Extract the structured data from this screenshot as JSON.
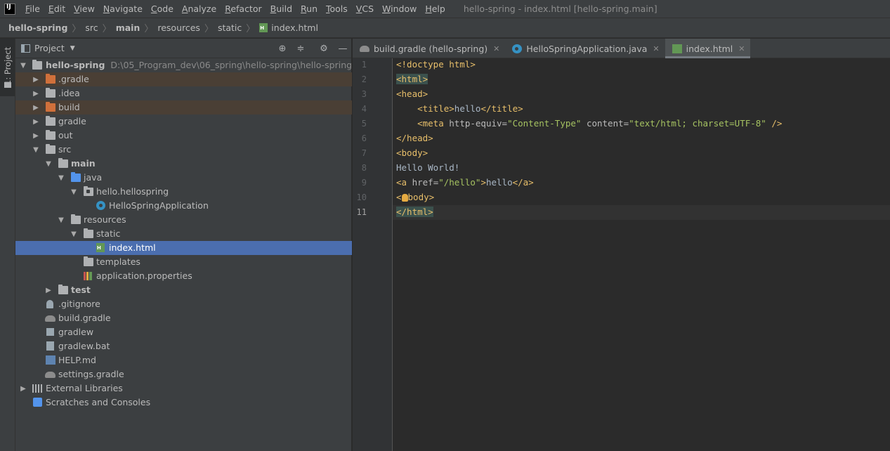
{
  "app": {
    "logo": "IJ",
    "window_title": "hello-spring - index.html [hello-spring.main]"
  },
  "menu": [
    "File",
    "Edit",
    "View",
    "Navigate",
    "Code",
    "Analyze",
    "Refactor",
    "Build",
    "Run",
    "Tools",
    "VCS",
    "Window",
    "Help"
  ],
  "breadcrumb": [
    "hello-spring",
    "src",
    "main",
    "resources",
    "static",
    "index.html"
  ],
  "left_stripe": {
    "label": "1: Project"
  },
  "project_panel": {
    "title": "Project"
  },
  "tree": [
    {
      "label": "hello-spring",
      "hint": "D:\\05_Program_dev\\06_spring\\hello-spring\\hello-spring",
      "icon": "module-folder-icon"
    },
    {
      "label": ".gradle",
      "icon": "folder-icon"
    },
    {
      "label": ".idea",
      "icon": "folder-icon"
    },
    {
      "label": "build",
      "icon": "folder-icon"
    },
    {
      "label": "gradle",
      "icon": "folder-icon"
    },
    {
      "label": "out",
      "icon": "folder-icon"
    },
    {
      "label": "src",
      "icon": "folder-icon"
    },
    {
      "label": "main",
      "icon": "folder-icon"
    },
    {
      "label": "java",
      "icon": "source-folder-icon"
    },
    {
      "label": "hello.hellospring",
      "icon": "package-icon"
    },
    {
      "label": "HelloSpringApplication",
      "icon": "spring-class-icon"
    },
    {
      "label": "resources",
      "icon": "resources-folder-icon"
    },
    {
      "label": "static",
      "icon": "folder-icon"
    },
    {
      "label": "index.html",
      "icon": "html-file-icon"
    },
    {
      "label": "templates",
      "icon": "folder-icon"
    },
    {
      "label": "application.properties",
      "icon": "properties-file-icon"
    },
    {
      "label": "test",
      "icon": "folder-icon"
    },
    {
      "label": ".gitignore",
      "icon": "gitignore-file-icon"
    },
    {
      "label": "build.gradle",
      "icon": "gradle-file-icon"
    },
    {
      "label": "gradlew",
      "icon": "shell-script-icon"
    },
    {
      "label": "gradlew.bat",
      "icon": "text-file-icon"
    },
    {
      "label": "HELP.md",
      "icon": "markdown-file-icon"
    },
    {
      "label": "settings.gradle",
      "icon": "gradle-file-icon"
    },
    {
      "label": "External Libraries",
      "icon": "libraries-icon"
    },
    {
      "label": "Scratches and Consoles",
      "icon": "scratches-icon"
    }
  ],
  "editor_tabs": [
    {
      "label": "build.gradle (hello-spring)",
      "icon": "gradle-file-icon"
    },
    {
      "label": "HelloSpringApplication.java",
      "icon": "spring-class-icon"
    },
    {
      "label": "index.html",
      "icon": "html-file-icon",
      "active": true
    }
  ],
  "line_numbers": [
    "1",
    "2",
    "3",
    "4",
    "5",
    "6",
    "7",
    "8",
    "9",
    "10",
    "11"
  ],
  "code": {
    "l1": "<!doctype html>",
    "l2": "<html>",
    "l3": "<head>",
    "l4_open": "<title>",
    "l4_text": "hello",
    "l4_close": "</title>",
    "l5_open": "<meta",
    "l5_attr1": " http-equiv=",
    "l5_val1": "\"Content-Type\"",
    "l5_attr2": " content=",
    "l5_val2": "\"text/html; charset=UTF-8\"",
    "l5_end": " />",
    "l6": "</head>",
    "l7": "<body>",
    "l8": "Hello World!",
    "l9_open": "<a",
    "l9_attr": " href=",
    "l9_val": "\"/hello\"",
    "l9_gt": ">",
    "l9_text": "hello",
    "l9_close": "</a>",
    "l10_a": "<",
    "l10_b": "body>",
    "l11": "</html>"
  }
}
